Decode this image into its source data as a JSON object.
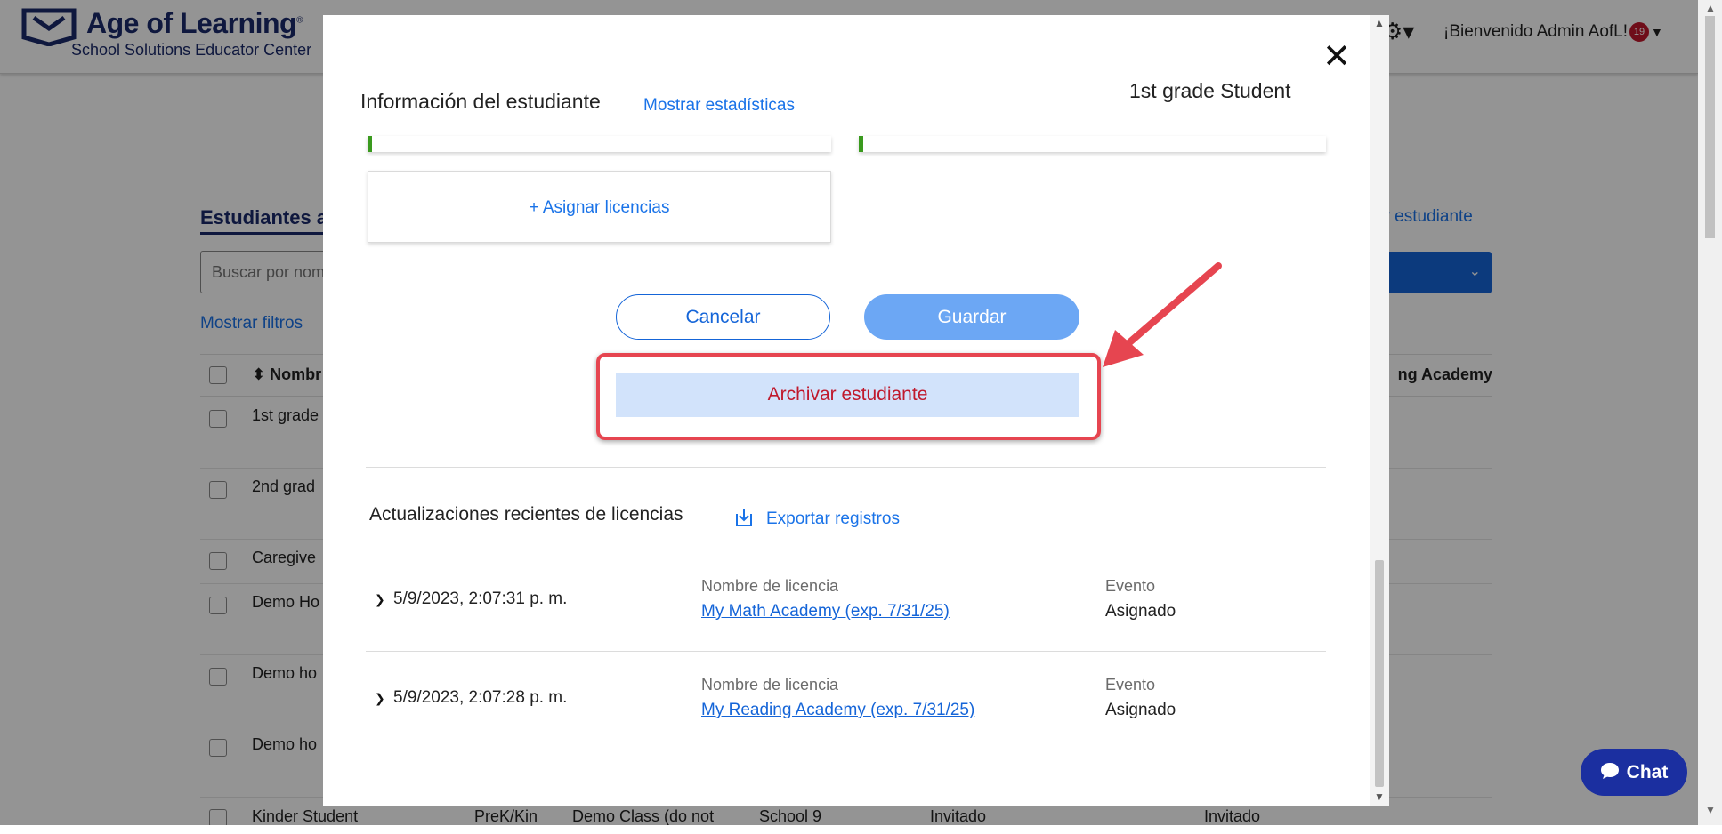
{
  "header": {
    "logo_title": "Age of Learning",
    "logo_reg": "®",
    "logo_subtitle": "School Solutions Educator Center",
    "welcome_text": "¡Bienvenido Admin AofL!",
    "notification_count": "19"
  },
  "background": {
    "students_title": "Estudiantes a",
    "search_placeholder": "Buscar por nom",
    "show_filters": "Mostrar filtros",
    "add_student_link": "ar estudiante",
    "table_header_name": "Nombr",
    "table_header_academy": "ng Academy",
    "rows": [
      {
        "name": "1st grade"
      },
      {
        "name": "2nd grad"
      },
      {
        "name": "Caregive"
      },
      {
        "name": "Demo Ho"
      },
      {
        "name": "Demo ho"
      },
      {
        "name": "Demo ho"
      }
    ],
    "last_row": {
      "name": "Kinder Student",
      "grade": "PreK/Kin",
      "class": "Demo Class (do not",
      "school": "School 9",
      "status1": "Invitado",
      "status2": "Invitado"
    }
  },
  "modal": {
    "section_title": "Información del estudiante",
    "show_stats": "Mostrar estadísticas",
    "student_name": "1st grade Student",
    "assign_licenses": "+ Asignar licencias",
    "cancel_label": "Cancelar",
    "save_label": "Guardar",
    "archive_label": "Archivar estudiante",
    "recent_title": "Actualizaciones recientes de licencias",
    "export_label": "Exportar registros",
    "license_updates": [
      {
        "timestamp": "5/9/2023, 2:07:31 p. m.",
        "license_label": "Nombre de licencia",
        "license_name": "My Math Academy (exp. 7/31/25)",
        "event_label": "Evento",
        "event_value": "Asignado"
      },
      {
        "timestamp": "5/9/2023, 2:07:28 p. m.",
        "license_label": "Nombre de licencia",
        "license_name": "My Reading Academy (exp. 7/31/25)",
        "event_label": "Evento",
        "event_value": "Asignado"
      }
    ]
  },
  "chat": {
    "label": "Chat"
  },
  "colors": {
    "brand_navy": "#1b2a6b",
    "link_blue": "#1a73e8",
    "primary_blue": "#1565d8",
    "save_blue": "#6ca7f4",
    "archive_bg": "#d2e3fb",
    "archive_text": "#c0192c",
    "annotation_red": "#e64550",
    "chat_bg": "#1b2fa0"
  }
}
